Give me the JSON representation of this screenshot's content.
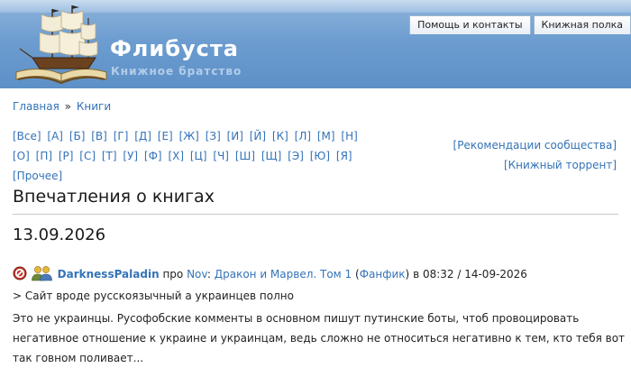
{
  "header": {
    "site_title": "Флибуста",
    "site_subtitle": "Книжное братство",
    "tabs": [
      {
        "label": "Помощь и контакты"
      },
      {
        "label": "Книжная полка"
      }
    ]
  },
  "breadcrumb": {
    "home": "Главная",
    "separator": "»",
    "current": "Книги"
  },
  "alphabet": [
    "[Все]",
    "[А]",
    "[Б]",
    "[В]",
    "[Г]",
    "[Д]",
    "[Е]",
    "[Ж]",
    "[З]",
    "[И]",
    "[Й]",
    "[К]",
    "[Л]",
    "[М]",
    "[Н]",
    "[О]",
    "[П]",
    "[Р]",
    "[С]",
    "[Т]",
    "[У]",
    "[Ф]",
    "[Х]",
    "[Ц]",
    "[Ч]",
    "[Ш]",
    "[Щ]",
    "[Э]",
    "[Ю]",
    "[Я]",
    "[Прочее]"
  ],
  "side_links": {
    "recommendations": "[Рекомендации сообщества]",
    "torrent": "[Книжный торрент]"
  },
  "page_title": "Впечатления о книгах",
  "date_heading": "13.09.2026",
  "review": {
    "username": "DarknessPaladin",
    "about_word": "про",
    "author": "Nov",
    "colon": ":",
    "book_title": "Дракон и Марвел. Том 1",
    "genre_open": "(",
    "genre": "Фанфик",
    "genre_close": ")",
    "time_text": "в 08:32 / 14-09-2026",
    "quote": "> Сайт вроде русскоязычный а украинцев полно",
    "body": "Это не украинцы. Русофобские комменты в основном пишут путинские боты, чтоб провоцировать негативное отношение к украине и украинцам, ведь сложно не относиться негативно к тем, кто тебя вот так говном поливает..."
  },
  "colors": {
    "link": "#3473b8",
    "header_blue": "#6d9dd0",
    "ban_red": "#c0392b"
  },
  "icons": [
    "ship-logo-icon",
    "ban-icon",
    "user-group-icon"
  ]
}
